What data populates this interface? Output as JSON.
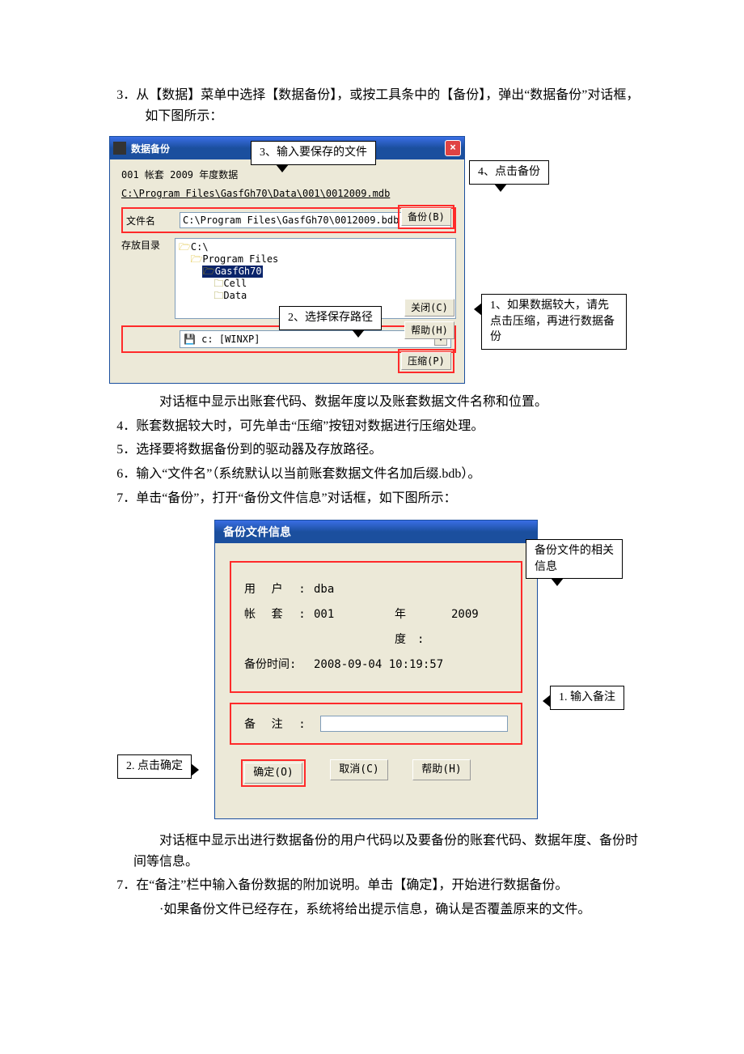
{
  "doc": {
    "step3": "3．从【数据】菜单中选择【数据备份】，或按工具条中的【备份】，弹出“数据备份”对话框，如下图所示：",
    "after_dlg1_line": "对话框中显示出账套代码、数据年度以及账套数据文件名称和位置。",
    "step4": "4．账套数据较大时，可先单击“压缩”按钮对数据进行压缩处理。",
    "step5": "5．选择要将数据备份到的驱动器及存放路径。",
    "step6": "6．输入“文件名”（系统默认以当前账套数据文件名加后缀.bdb）。",
    "step7": "7．单击“备份”，打开“备份文件信息”对话框，如下图所示：",
    "after_dlg2_line": "对话框中显示出进行数据备份的用户代码以及要备份的账套代码、数据年度、备份时间等信息。",
    "step7b": "7．在“备注”栏中输入备份数据的附加说明。单击【确定】，开始进行数据备份。",
    "bullet": "·如果备份文件已经存在，系统将给出提示信息，确认是否覆盖原来的文件。"
  },
  "dlg1": {
    "title": "数据备份",
    "header_line": "001 帐套 2009 年度数据",
    "source_path": "C:\\Program Files\\GasfGh70\\Data\\001\\0012009.mdb",
    "file_label": "文件名",
    "file_value": "C:\\Program Files\\GasfGh70\\0012009.bdb",
    "dir_label": "存放目录",
    "tree": {
      "root": "C:\\",
      "l1": "Program Files",
      "selected": "GasfGh70",
      "child1": "Cell",
      "child2": "Data"
    },
    "drive": "c: [WINXP]",
    "btn_backup": "备份(B)",
    "btn_close": "关闭(C)",
    "btn_help": "帮助(H)",
    "btn_compress": "压缩(P)"
  },
  "callouts1": {
    "c1": "1、如果数据较大，请先点击压缩，再进行数据备份",
    "c2": "2、选择保存路径",
    "c3": "3、输入要保存的文件",
    "c4": "4、点击备份"
  },
  "dlg2": {
    "title": "备份文件信息",
    "user_lbl": "用户",
    "user_val": "dba",
    "acct_lbl": "帐套",
    "acct_val": "001",
    "year_lbl": "年度",
    "year_val": "2009",
    "time_lbl": "备份时间",
    "time_val": "2008-09-04 10:19:57",
    "note_lbl": "备注",
    "note_val": "",
    "btn_ok": "确定(O)",
    "btn_cancel": "取消(C)",
    "btn_help": "帮助(H)"
  },
  "callouts2": {
    "info": "备份文件的相关信息",
    "c1": "1. 输入备注",
    "c2": "2. 点击确定"
  }
}
